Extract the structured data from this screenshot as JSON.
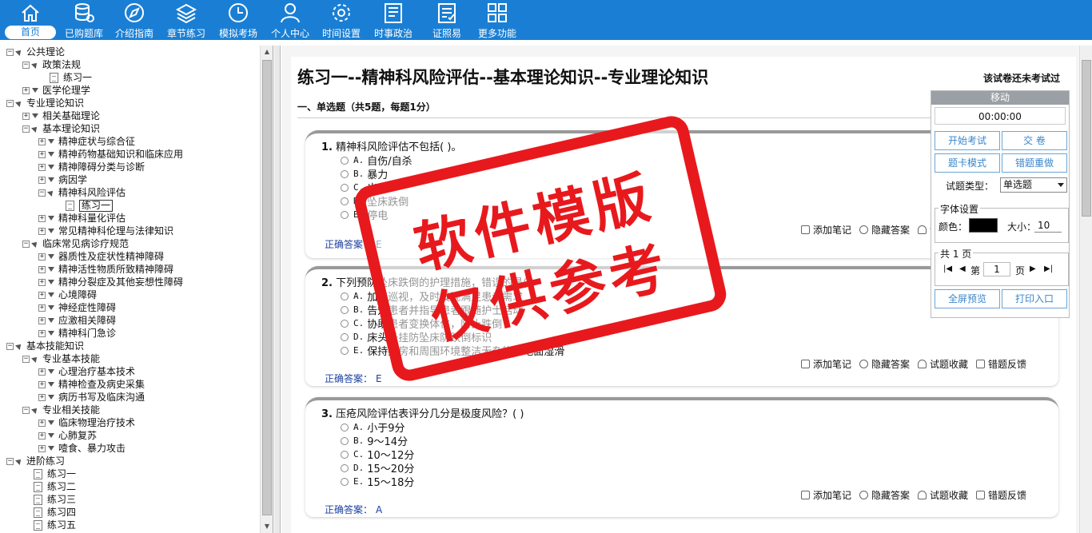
{
  "nav": {
    "items": [
      {
        "label": "首页",
        "icon": "home-icon",
        "active": true
      },
      {
        "label": "已购题库",
        "icon": "database-icon"
      },
      {
        "label": "介绍指南",
        "icon": "compass-icon"
      },
      {
        "label": "章节练习",
        "icon": "layers-icon"
      },
      {
        "label": "模拟考场",
        "icon": "clock-icon"
      },
      {
        "label": "个人中心",
        "icon": "user-icon"
      },
      {
        "label": "时间设置",
        "icon": "gear-icon"
      },
      {
        "label": "时事政治",
        "icon": "news-icon"
      },
      {
        "label": "证照易",
        "icon": "checklist-icon"
      },
      {
        "label": "更多功能",
        "icon": "grid-icon"
      }
    ]
  },
  "tree": {
    "nodes": [
      {
        "label": "公共理论",
        "level": 0,
        "kind": "open"
      },
      {
        "label": "政策法规",
        "level": 1,
        "kind": "open"
      },
      {
        "label": "练习一",
        "level": 2,
        "kind": "doc"
      },
      {
        "label": "医学伦理学",
        "level": 1,
        "kind": "closed"
      },
      {
        "label": "专业理论知识",
        "level": 0,
        "kind": "open"
      },
      {
        "label": "相关基础理论",
        "level": 1,
        "kind": "closed"
      },
      {
        "label": "基本理论知识",
        "level": 1,
        "kind": "open"
      },
      {
        "label": "精神症状与综合征",
        "level": 2,
        "kind": "closed"
      },
      {
        "label": "精神药物基础知识和临床应用",
        "level": 2,
        "kind": "closed"
      },
      {
        "label": "精神障碍分类与诊断",
        "level": 2,
        "kind": "closed"
      },
      {
        "label": "病因学",
        "level": 2,
        "kind": "closed"
      },
      {
        "label": "精神科风险评估",
        "level": 2,
        "kind": "open"
      },
      {
        "label": "练习一",
        "level": 3,
        "kind": "docsel"
      },
      {
        "label": "精神科量化评估",
        "level": 2,
        "kind": "closed"
      },
      {
        "label": "常见精神科伦理与法律知识",
        "level": 2,
        "kind": "closed"
      },
      {
        "label": "临床常见病诊疗规范",
        "level": 1,
        "kind": "open"
      },
      {
        "label": "器质性及症状性精神障碍",
        "level": 2,
        "kind": "closed"
      },
      {
        "label": "精神活性物质所致精神障碍",
        "level": 2,
        "kind": "closed"
      },
      {
        "label": "精神分裂症及其他妄想性障碍",
        "level": 2,
        "kind": "closed"
      },
      {
        "label": "心境障碍",
        "level": 2,
        "kind": "closed"
      },
      {
        "label": "神经症性障碍",
        "level": 2,
        "kind": "closed"
      },
      {
        "label": "应激相关障碍",
        "level": 2,
        "kind": "closed"
      },
      {
        "label": "精神科门急诊",
        "level": 2,
        "kind": "closed"
      },
      {
        "label": "基本技能知识",
        "level": 0,
        "kind": "open"
      },
      {
        "label": "专业基本技能",
        "level": 1,
        "kind": "open"
      },
      {
        "label": "心理治疗基本技术",
        "level": 2,
        "kind": "closed"
      },
      {
        "label": "精神检查及病史采集",
        "level": 2,
        "kind": "closed"
      },
      {
        "label": "病历书写及临床沟通",
        "level": 2,
        "kind": "closed"
      },
      {
        "label": "专业相关技能",
        "level": 1,
        "kind": "open"
      },
      {
        "label": "临床物理治疗技术",
        "level": 2,
        "kind": "closed"
      },
      {
        "label": "心肺复苏",
        "level": 2,
        "kind": "closed"
      },
      {
        "label": "噎食、暴力攻击",
        "level": 2,
        "kind": "closed"
      },
      {
        "label": "进阶练习",
        "level": 0,
        "kind": "open"
      },
      {
        "label": "练习一",
        "level": 1,
        "kind": "doc"
      },
      {
        "label": "练习二",
        "level": 1,
        "kind": "doc"
      },
      {
        "label": "练习三",
        "level": 1,
        "kind": "doc"
      },
      {
        "label": "练习四",
        "level": 1,
        "kind": "doc"
      },
      {
        "label": "练习五",
        "level": 1,
        "kind": "doc"
      }
    ]
  },
  "paper": {
    "title": "练习一--精神科风险评估--基本理论知识--专业理论知识",
    "status": "该试卷还未考试过",
    "section": "一、单选题（共5题，每题1分）",
    "answer_label": "正确答案：",
    "tools": {
      "note": "添加笔记",
      "hide": "隐藏答案",
      "fav": "试题收藏",
      "report": "错题反馈"
    },
    "questions": [
      {
        "num": "1.",
        "text": "精神科风险评估不包括(  )。",
        "options": [
          {
            "letter": "A.",
            "text": "自伤/自杀"
          },
          {
            "letter": "B.",
            "text": "暴力"
          },
          {
            "letter": "C.",
            "text": "出走"
          },
          {
            "letter": "D.",
            "text": "坠床跌倒"
          },
          {
            "letter": "E.",
            "text": "停电"
          }
        ],
        "answer": "E"
      },
      {
        "num": "2.",
        "text": "下列预防坠床跌倒的护理措施，错误的是(  )",
        "options": [
          {
            "letter": "A.",
            "text": "加强巡视，及时发现满足患者需求"
          },
          {
            "letter": "B.",
            "text": "告知患者并指导患者跟随护士活动"
          },
          {
            "letter": "C.",
            "text": "协助患者变换体位，防止跌倒"
          },
          {
            "letter": "D.",
            "text": "床头悬挂防坠床防跌倒标识"
          },
          {
            "letter": "E.",
            "text": "保持病房和周围环境整洁无杂物，地面湿滑"
          }
        ],
        "answer": "E"
      },
      {
        "num": "3.",
        "text": "压疮风险评估表评分几分是极度风险？(  )",
        "options": [
          {
            "letter": "A.",
            "text": "小于9分"
          },
          {
            "letter": "B.",
            "text": "9～14分"
          },
          {
            "letter": "C.",
            "text": "10～12分"
          },
          {
            "letter": "D.",
            "text": "15～20分"
          },
          {
            "letter": "E.",
            "text": "15～18分"
          }
        ],
        "answer": "A"
      }
    ]
  },
  "panel": {
    "move": "移动",
    "timer": "00:00:00",
    "start": "开始考试",
    "submit": "交    卷",
    "card_mode": "题卡模式",
    "redo": "错题重做",
    "type_label": "试题类型：",
    "type_value": "单选题",
    "font_title": "字体设置",
    "color_label": "颜色：",
    "size_label": "大小：",
    "size_value": "10",
    "font_color": "#000000",
    "pages_title": "共 1 页",
    "page_prefix": "第",
    "page_value": "1",
    "page_suffix": "页",
    "fullscreen": "全屏预览",
    "print": "打印入口"
  },
  "watermark": {
    "line1": "软件模版",
    "line2": "仅供参考"
  },
  "colors": {
    "topbar": "#1a7fd4",
    "stamp": "#e8191d",
    "answer": "#1b3fa0"
  }
}
